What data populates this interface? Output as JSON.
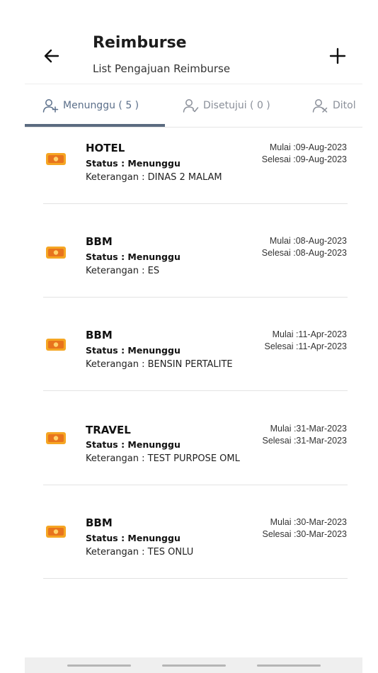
{
  "header": {
    "title": "Reimburse",
    "subtitle": "List Pengajuan Reimburse"
  },
  "tabs": [
    {
      "label": "Menunggu ( 5 )",
      "icon": "user-plus-icon",
      "active": true
    },
    {
      "label": "Disetujui ( 0 )",
      "icon": "user-check-icon",
      "active": false
    },
    {
      "label": "Ditol",
      "icon": "user-x-icon",
      "active": false
    }
  ],
  "colors": {
    "accent": "#5b6b80",
    "icon_orange": "#f5a623",
    "icon_dark_orange": "#e8741d"
  },
  "items": [
    {
      "category": "HOTEL",
      "status": "Status : Menunggu",
      "note": "Keterangan : DINAS 2 MALAM",
      "start": "Mulai :09-Aug-2023",
      "end": "Selesai :09-Aug-2023"
    },
    {
      "category": "BBM",
      "status": "Status : Menunggu",
      "note": "Keterangan : ES",
      "start": "Mulai :08-Aug-2023",
      "end": "Selesai :08-Aug-2023"
    },
    {
      "category": "BBM",
      "status": "Status : Menunggu",
      "note": "Keterangan : BENSIN PERTALITE",
      "start": "Mulai :11-Apr-2023",
      "end": "Selesai :11-Apr-2023"
    },
    {
      "category": "TRAVEL",
      "status": "Status : Menunggu",
      "note": "Keterangan : TEST PURPOSE OML",
      "start": "Mulai :31-Mar-2023",
      "end": "Selesai :31-Mar-2023"
    },
    {
      "category": "BBM",
      "status": "Status : Menunggu",
      "note": "Keterangan : TES ONLU",
      "start": "Mulai :30-Mar-2023",
      "end": "Selesai :30-Mar-2023"
    }
  ]
}
